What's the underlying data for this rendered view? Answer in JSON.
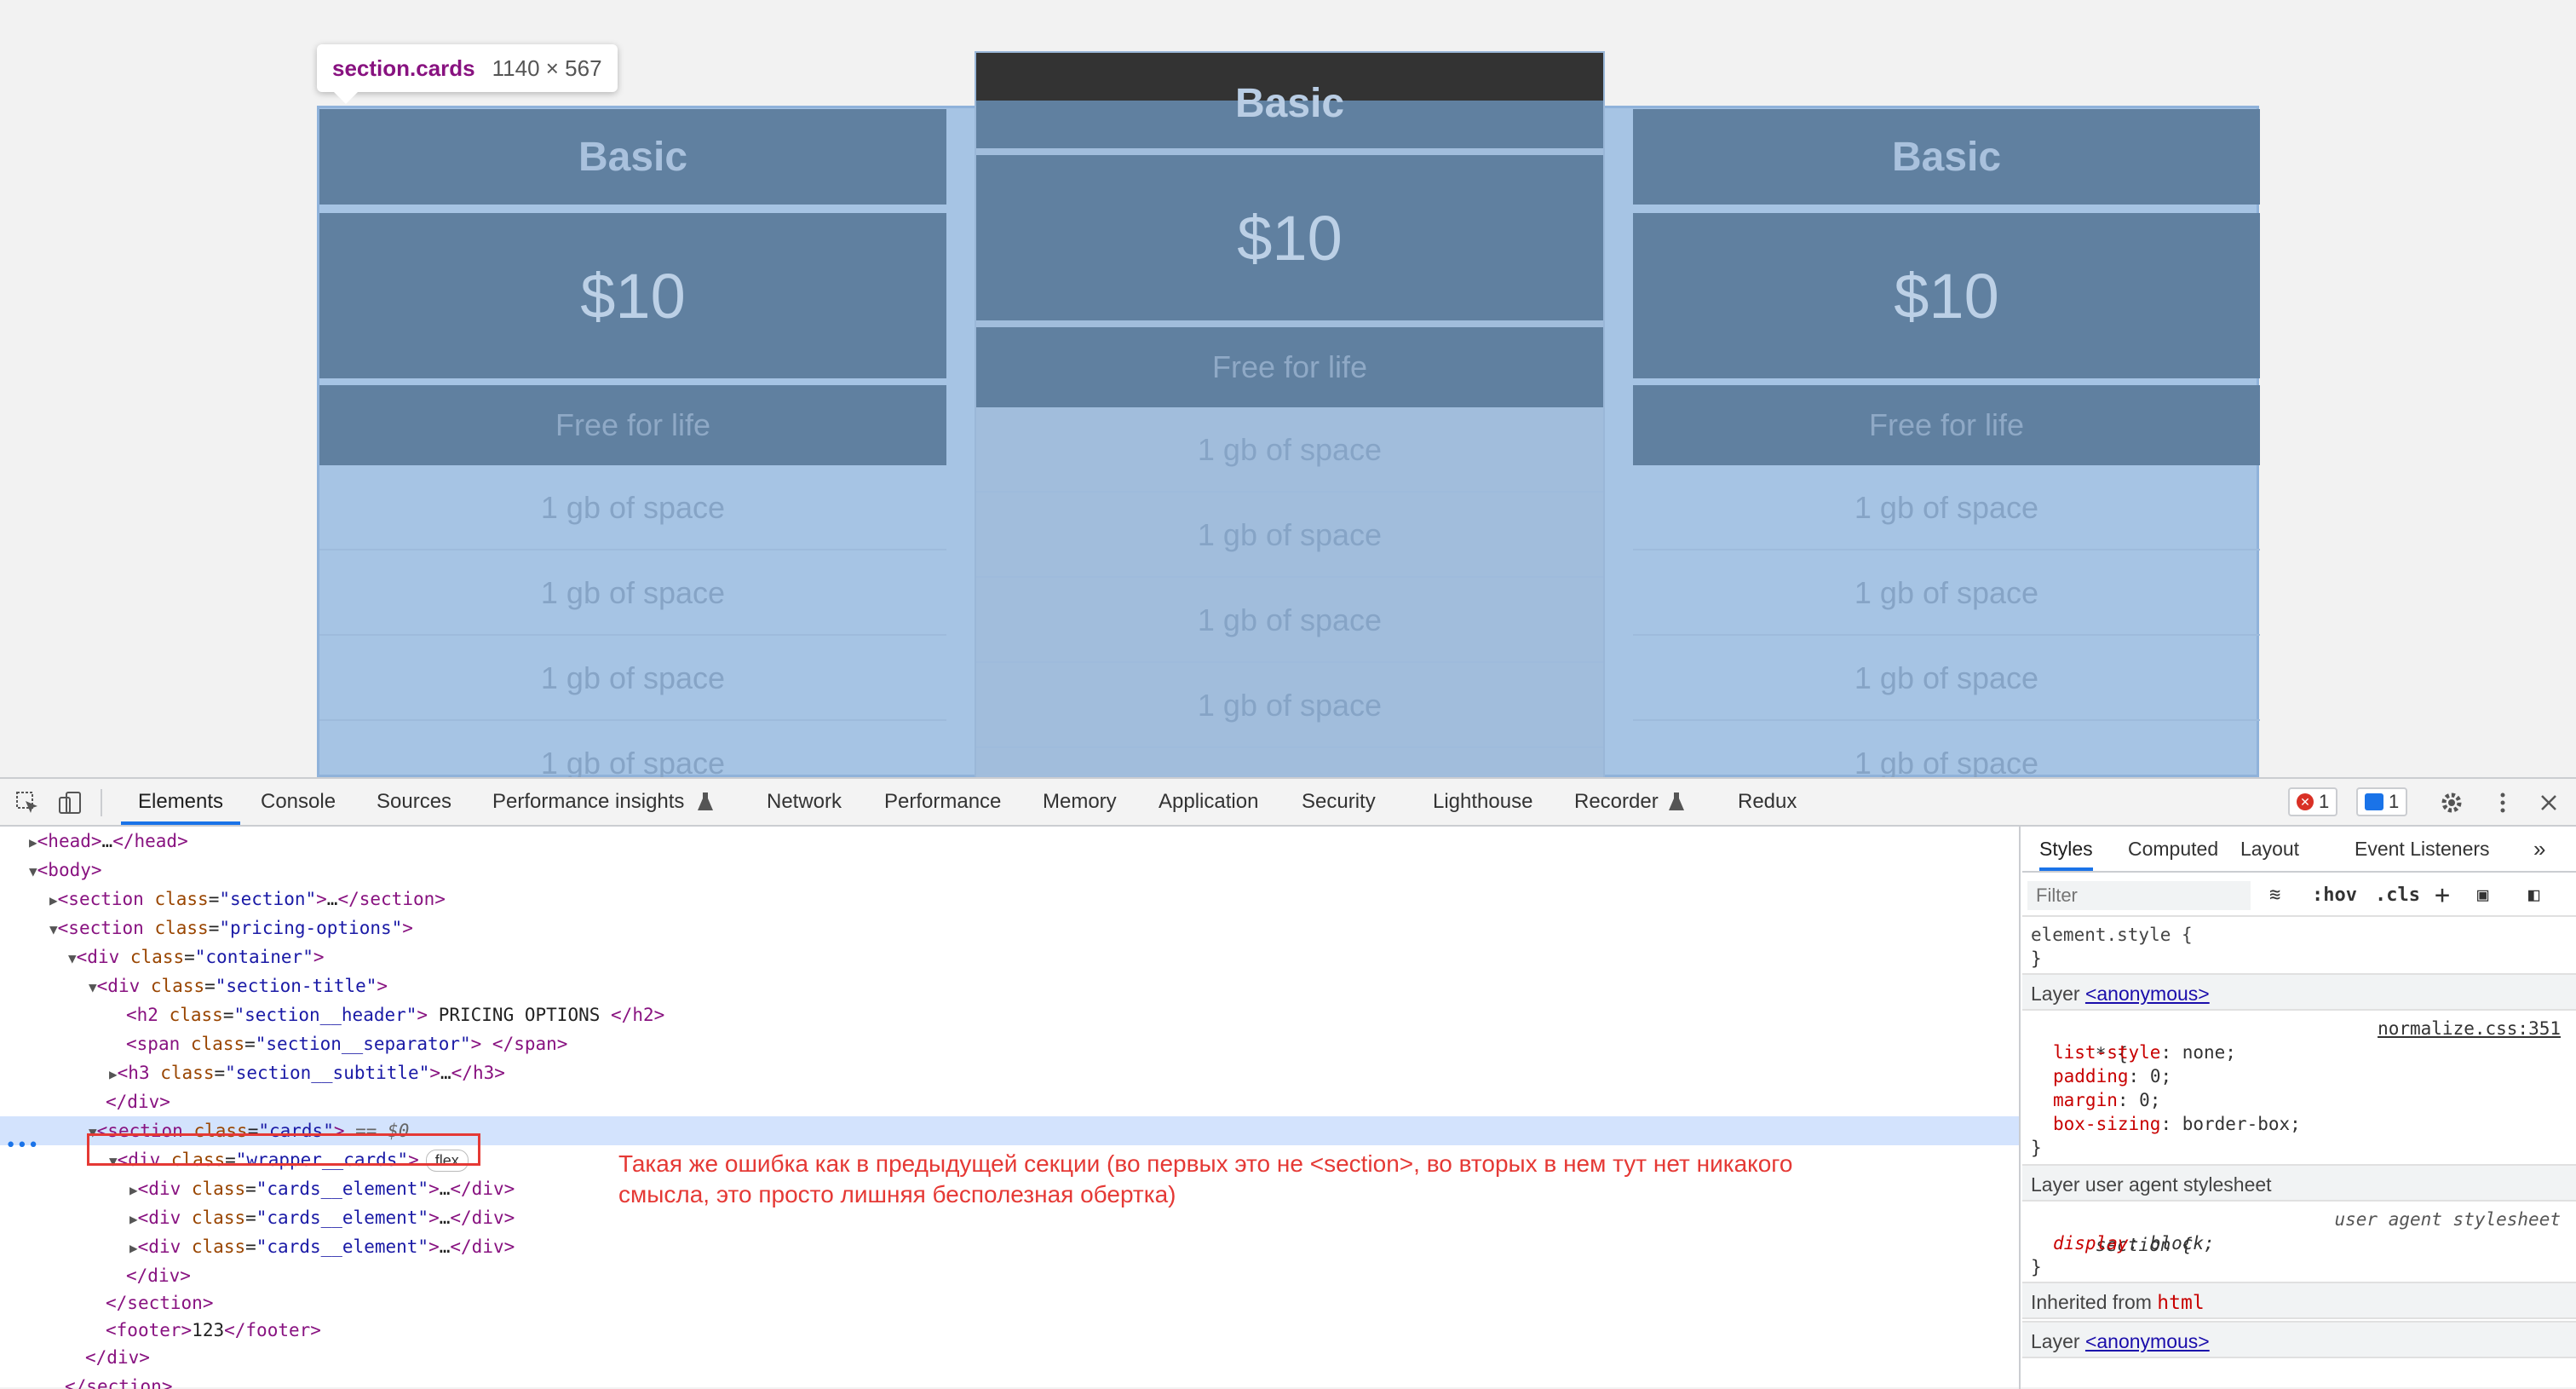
{
  "page": {
    "tooltip": {
      "selector": "section.cards",
      "size": "1140 × 567"
    },
    "cards": [
      {
        "title": "Basic",
        "price": "$10",
        "subtitle": "Free for life",
        "features": [
          "1 gb of space",
          "1 gb of space",
          "1 gb of space",
          "1 gb of space"
        ]
      },
      {
        "title": "Basic",
        "price": "$10",
        "subtitle": "Free for life",
        "features": [
          "1 gb of space",
          "1 gb of space",
          "1 gb of space",
          "1 gb of space"
        ]
      },
      {
        "title": "Basic",
        "price": "$10",
        "subtitle": "Free for life",
        "features": [
          "1 gb of space",
          "1 gb of space",
          "1 gb of space",
          "1 gb of space"
        ]
      }
    ]
  },
  "devtools": {
    "tabs": [
      "Elements",
      "Console",
      "Sources",
      "Performance insights",
      "Network",
      "Performance",
      "Memory",
      "Application",
      "Security",
      "Lighthouse",
      "Recorder",
      "Redux"
    ],
    "active_tab": "Elements",
    "errors_count": "1",
    "messages_count": "1",
    "icons": [
      "inspect-icon",
      "device-toggle-icon",
      "error-icon",
      "message-icon",
      "settings-icon",
      "more-icon",
      "close-icon"
    ],
    "dom": {
      "l1_head": "head",
      "l1_head_ellipsis": "…",
      "l2_body": "body",
      "l3_tag": "section",
      "l3_attr": "class",
      "l3_val": "\"section\"",
      "l4_tag": "section",
      "l4_val": "\"pricing-options\"",
      "l5_tag": "div",
      "l5_val": "\"container\"",
      "l6_tag": "div",
      "l6_val": "\"section-title\"",
      "l7_tag": "h2",
      "l7_val": "\"section__header\"",
      "l7_text": " PRICING OPTIONS ",
      "l8_tag": "span",
      "l8_val": "\"section__separator\"",
      "l9_tag": "h3",
      "l9_val": "\"section__subtitle\"",
      "l10_close": "div",
      "l11_tag": "section",
      "l11_val": "\"cards\"",
      "l11_eq": " == $0",
      "l12_tag": "div",
      "l12_val": "\"wrapper__cards\"",
      "l12_badge": "flex",
      "l13_tag": "div",
      "l13_val": "\"cards__element\"",
      "l16_close": "div",
      "l17_close": "section",
      "l18_tag": "footer",
      "l18_text": "123",
      "l19_close": "div",
      "l20_close": "section"
    },
    "annotation": "Такая же ошибка как в предыдущей секции (во первых это не <section>, во вторых в нем тут нет никакого смысла, это просто лишняя бесполезная обертка)",
    "styles": {
      "tabs": [
        "Styles",
        "Computed",
        "Layout",
        "Event Listeners"
      ],
      "active_tab": "Styles",
      "filter_placeholder": "Filter",
      "hov": ":hov",
      "cls": ".cls",
      "element_style": "element.style {",
      "close_brace": "}",
      "layer_label": "Layer",
      "layer_link": "<anonymous>",
      "rule1_selector": "* {",
      "rule1_source": "normalize.css:351",
      "rule1_props": [
        {
          "name": "list-style",
          "value": "none;"
        },
        {
          "name": "padding",
          "value": "0;"
        },
        {
          "name": "margin",
          "value": "0;"
        },
        {
          "name": "box-sizing",
          "value": "border-box;"
        }
      ],
      "ua_layer": "Layer user agent stylesheet",
      "rule2_selector": "section {",
      "rule2_source": "user agent stylesheet",
      "rule2_prop": "display",
      "rule2_value": "block;",
      "inherited": "Inherited from",
      "inherited_tag": "html",
      "layer2_link": "<anonymous>"
    }
  }
}
